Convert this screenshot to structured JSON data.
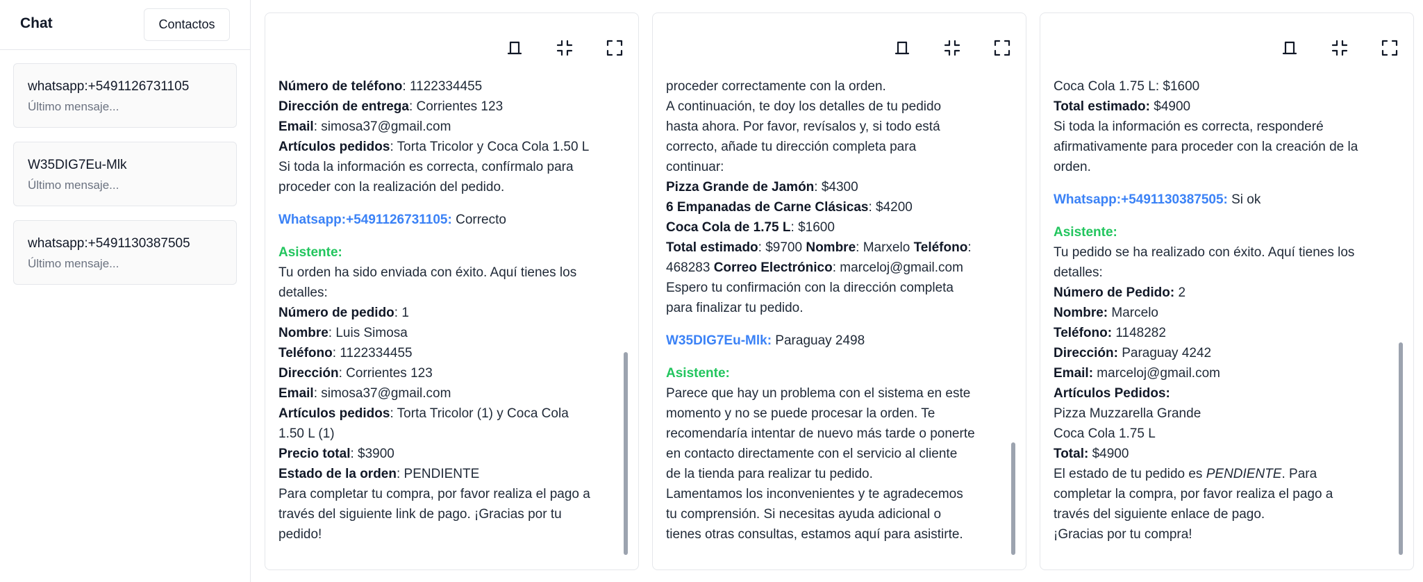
{
  "sidebar": {
    "title": "Chat",
    "contacts_button": "Contactos",
    "chats": [
      {
        "name": "whatsapp:+5491126731105",
        "last": "Último mensaje..."
      },
      {
        "name": "W35DIG7Eu-Mlk",
        "last": "Último mensaje..."
      },
      {
        "name": "whatsapp:+5491130387505",
        "last": "Último mensaje..."
      }
    ]
  },
  "panels": [
    {
      "lines": [
        {
          "b": "Número de teléfono",
          "t": ": 1122334455"
        },
        {
          "b": "Dirección de entrega",
          "t": ": Corrientes 123"
        },
        {
          "b": "Email",
          "t": ": simosa37@gmail.com"
        },
        {
          "b": "Artículos pedidos",
          "t": ": Torta Tricolor y Coca Cola 1.50 L"
        },
        {
          "t": "Si toda la información es correcta, confírmalo para"
        },
        {
          "t": "proceder con la realización del pedido."
        },
        {
          "gap": true
        },
        {
          "su": "Whatsapp:+5491126731105:",
          "t": " Correcto"
        },
        {
          "gap": true
        },
        {
          "sb": "Asistente:"
        },
        {
          "t": "Tu orden ha sido enviada con éxito. Aquí tienes los"
        },
        {
          "t": "detalles:"
        },
        {
          "b": "Número de pedido",
          "t": ": 1"
        },
        {
          "b": "Nombre",
          "t": ": Luis Simosa"
        },
        {
          "b": "Teléfono",
          "t": ": 1122334455"
        },
        {
          "b": "Dirección",
          "t": ": Corrientes 123"
        },
        {
          "b": "Email",
          "t": ": simosa37@gmail.com"
        },
        {
          "b": "Artículos pedidos",
          "t": ": Torta Tricolor (1) y Coca Cola"
        },
        {
          "t": "1.50 L (1)"
        },
        {
          "b": "Precio total",
          "t": ": $3900"
        },
        {
          "b": "Estado de la orden",
          "t": ": PENDIENTE"
        },
        {
          "t": "Para completar tu compra, por favor realiza el pago a"
        },
        {
          "t": "través del siguiente link de pago. ¡Gracias por tu"
        },
        {
          "t": "pedido!"
        }
      ]
    },
    {
      "lines": [
        {
          "t": "proceder correctamente con la orden."
        },
        {
          "t": "A continuación, te doy los detalles de tu pedido"
        },
        {
          "t": "hasta ahora. Por favor, revísalos y, si todo está"
        },
        {
          "t": "correcto, añade tu dirección completa para"
        },
        {
          "t": "continuar:"
        },
        {
          "b": "Pizza Grande de Jamón",
          "t": ": $4300"
        },
        {
          "b": "6 Empanadas de Carne Clásicas",
          "t": ": $4200"
        },
        {
          "b": "Coca Cola de 1.75 L",
          "t": ": $1600"
        },
        {
          "b": "Total estimado",
          "t": ": $9700 ",
          "b2": "Nombre",
          "t2": ": Marxelo ",
          "b3": "Teléfono",
          "t3": ":"
        },
        {
          "t": "468283 ",
          "b2": "Correo Electrónico",
          "t2": ": marceloj@gmail.com"
        },
        {
          "t": "Espero tu confirmación con la dirección completa"
        },
        {
          "t": "para finalizar tu pedido."
        },
        {
          "gap": true
        },
        {
          "su": "W35DIG7Eu-Mlk:",
          "t": " Paraguay 2498"
        },
        {
          "gap": true
        },
        {
          "sb": "Asistente:"
        },
        {
          "t": "Parece que hay un problema con el sistema en este"
        },
        {
          "t": "momento y no se puede procesar la orden. Te"
        },
        {
          "t": "recomendaría intentar de nuevo más tarde o ponerte"
        },
        {
          "t": "en contacto directamente con el servicio al cliente"
        },
        {
          "t": "de la tienda para realizar tu pedido."
        },
        {
          "t": "Lamentamos los inconvenientes y te agradecemos"
        },
        {
          "t": "tu comprensión. Si necesitas ayuda adicional o"
        },
        {
          "t": "tienes otras consultas, estamos aquí para asistirte."
        }
      ]
    },
    {
      "lines": [
        {
          "t": "Coca Cola 1.75 L: $1600"
        },
        {
          "b": "Total estimado:",
          "t": " $4900"
        },
        {
          "t": "Si toda la información es correcta, responderé"
        },
        {
          "t": "afirmativamente para proceder con la creación de la"
        },
        {
          "t": "orden."
        },
        {
          "gap": true
        },
        {
          "su": "Whatsapp:+5491130387505:",
          "t": " Si ok"
        },
        {
          "gap": true
        },
        {
          "sb": "Asistente:"
        },
        {
          "t": "Tu pedido se ha realizado con éxito. Aquí tienes los"
        },
        {
          "t": "detalles:"
        },
        {
          "b": "Número de Pedido:",
          "t": " 2"
        },
        {
          "b": "Nombre:",
          "t": " Marcelo"
        },
        {
          "b": "Teléfono:",
          "t": " 1148282"
        },
        {
          "b": "Dirección:",
          "t": " Paraguay 4242"
        },
        {
          "b": "Email:",
          "t": " marceloj@gmail.com"
        },
        {
          "b": "Artículos Pedidos:"
        },
        {
          "t": "Pizza Muzzarella Grande"
        },
        {
          "t": "Coca Cola 1.75 L"
        },
        {
          "b": "Total:",
          "t": " $4900"
        },
        {
          "t": "El estado de tu pedido es ",
          "i": "PENDIENTE",
          "t2": ". Para"
        },
        {
          "t": "completar la compra, por favor realiza el pago a"
        },
        {
          "t": "través del siguiente enlace de pago."
        },
        {
          "t": "¡Gracias por tu compra!"
        }
      ]
    }
  ]
}
